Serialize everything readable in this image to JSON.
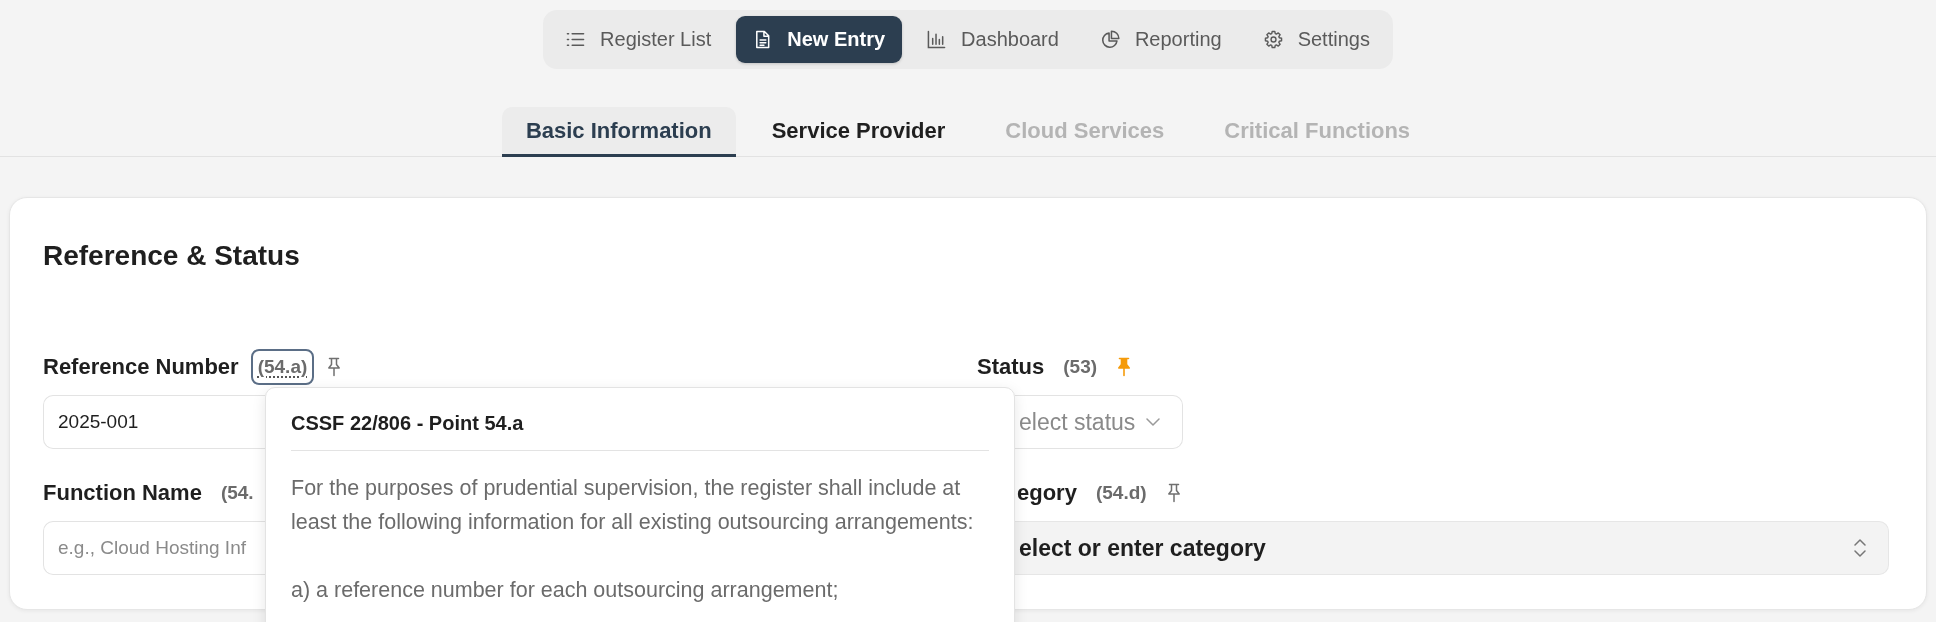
{
  "nav": [
    {
      "label": "Register List",
      "selected": false
    },
    {
      "label": "New Entry",
      "selected": true
    },
    {
      "label": "Dashboard",
      "selected": false
    },
    {
      "label": "Reporting",
      "selected": false
    },
    {
      "label": "Settings",
      "selected": false
    }
  ],
  "tabs": [
    {
      "label": "Basic Information",
      "selected": true,
      "disabled": false
    },
    {
      "label": "Service Provider",
      "selected": false,
      "disabled": false
    },
    {
      "label": "Cloud Services",
      "selected": false,
      "disabled": true
    },
    {
      "label": "Critical Functions",
      "selected": false,
      "disabled": true
    }
  ],
  "section": {
    "title": "Reference & Status",
    "fields": [
      {
        "kind": "text",
        "label": "Reference Number",
        "code": "(54.a)",
        "code_focused": true,
        "pinned": false,
        "value": "2025-001"
      },
      {
        "kind": "select",
        "label": "Status",
        "code": "(53)",
        "code_focused": false,
        "pinned": true,
        "placeholder": "elect status"
      },
      {
        "kind": "text",
        "label": "Function Name",
        "code": "(54.",
        "code_focused": false,
        "placeholder": "e.g., Cloud Hosting Inf"
      },
      {
        "kind": "combobox",
        "label": "egory",
        "code": "(54.d)",
        "code_focused": false,
        "pinned": false,
        "placeholder": "elect or enter category"
      }
    ]
  },
  "popover": {
    "title": "CSSF 22/806 - Point 54.a",
    "paragraphs": [
      "For the purposes of prudential supervision, the register shall include at least the following information for all existing outsourcing arrangements:",
      "a) a reference number for each outsourcing arrangement;"
    ]
  }
}
